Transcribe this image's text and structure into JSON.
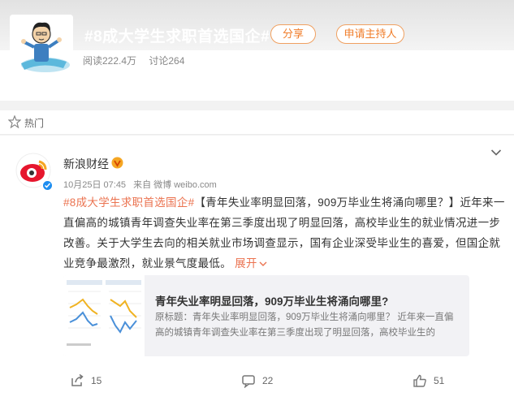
{
  "topic": {
    "title": "#8成大学生求职首选国企#",
    "share_label": "分享",
    "host_label": "申请主持人",
    "reads": "阅读222.4万",
    "discussions": "讨论264"
  },
  "tabs": {
    "hot_label": "热门"
  },
  "post": {
    "author": "新浪财经",
    "time": "10月25日 07:45",
    "source": "来自 微博 weibo.com",
    "hashtag": "#8成大学生求职首选国企#",
    "body": "【青年失业率明显回落，909万毕业生将涌向哪里？】近年来一直偏高的城镇青年调查失业率在第三季度出现了明显回落，高校毕业生的就业情况进一步改善。关于大学生去向的相关就业市场调查显示，国有企业深受毕业生的喜爱，但国企就业竞争最激烈，就业景气度最低。",
    "expand_label": "展开"
  },
  "link_card": {
    "title": "青年失业率明显回落，909万毕业生将涌向哪里?",
    "description": "原标题：青年失业率明显回落，909万毕业生将涌向哪里？ 近年来一直偏高的城镇青年调查失业率在第三季度出现了明显回落，高校毕业生的"
  },
  "actions": {
    "shares": "15",
    "comments": "22",
    "likes": "51"
  },
  "colors": {
    "accent_orange": "#eb7350",
    "verified_blue": "#1d8df0"
  }
}
